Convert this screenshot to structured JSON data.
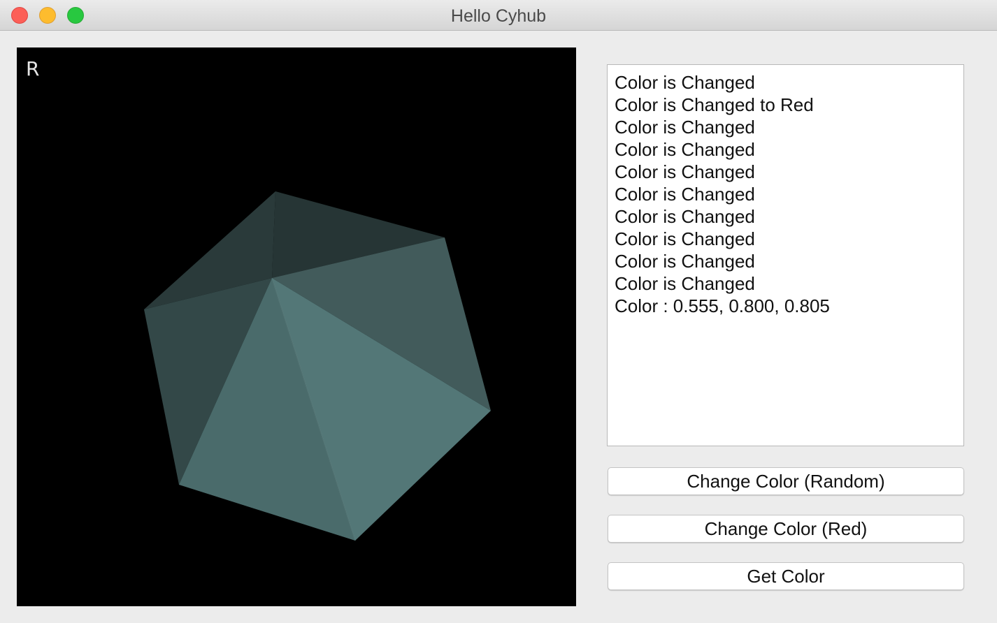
{
  "window": {
    "title": "Hello Cyhub"
  },
  "viewport": {
    "label": "R",
    "background": "#000000",
    "object_color": "#577979"
  },
  "log": {
    "lines": [
      "Color is Changed",
      "Color is Changed to Red",
      "Color is Changed",
      "Color is Changed",
      "Color is Changed",
      "Color is Changed",
      "Color is Changed",
      "Color is Changed",
      "Color is Changed",
      "Color is Changed",
      "Color : 0.555, 0.800, 0.805"
    ]
  },
  "buttons": {
    "random_label": "Change Color (Random)",
    "red_label": "Change Color (Red)",
    "get_label": "Get Color"
  }
}
